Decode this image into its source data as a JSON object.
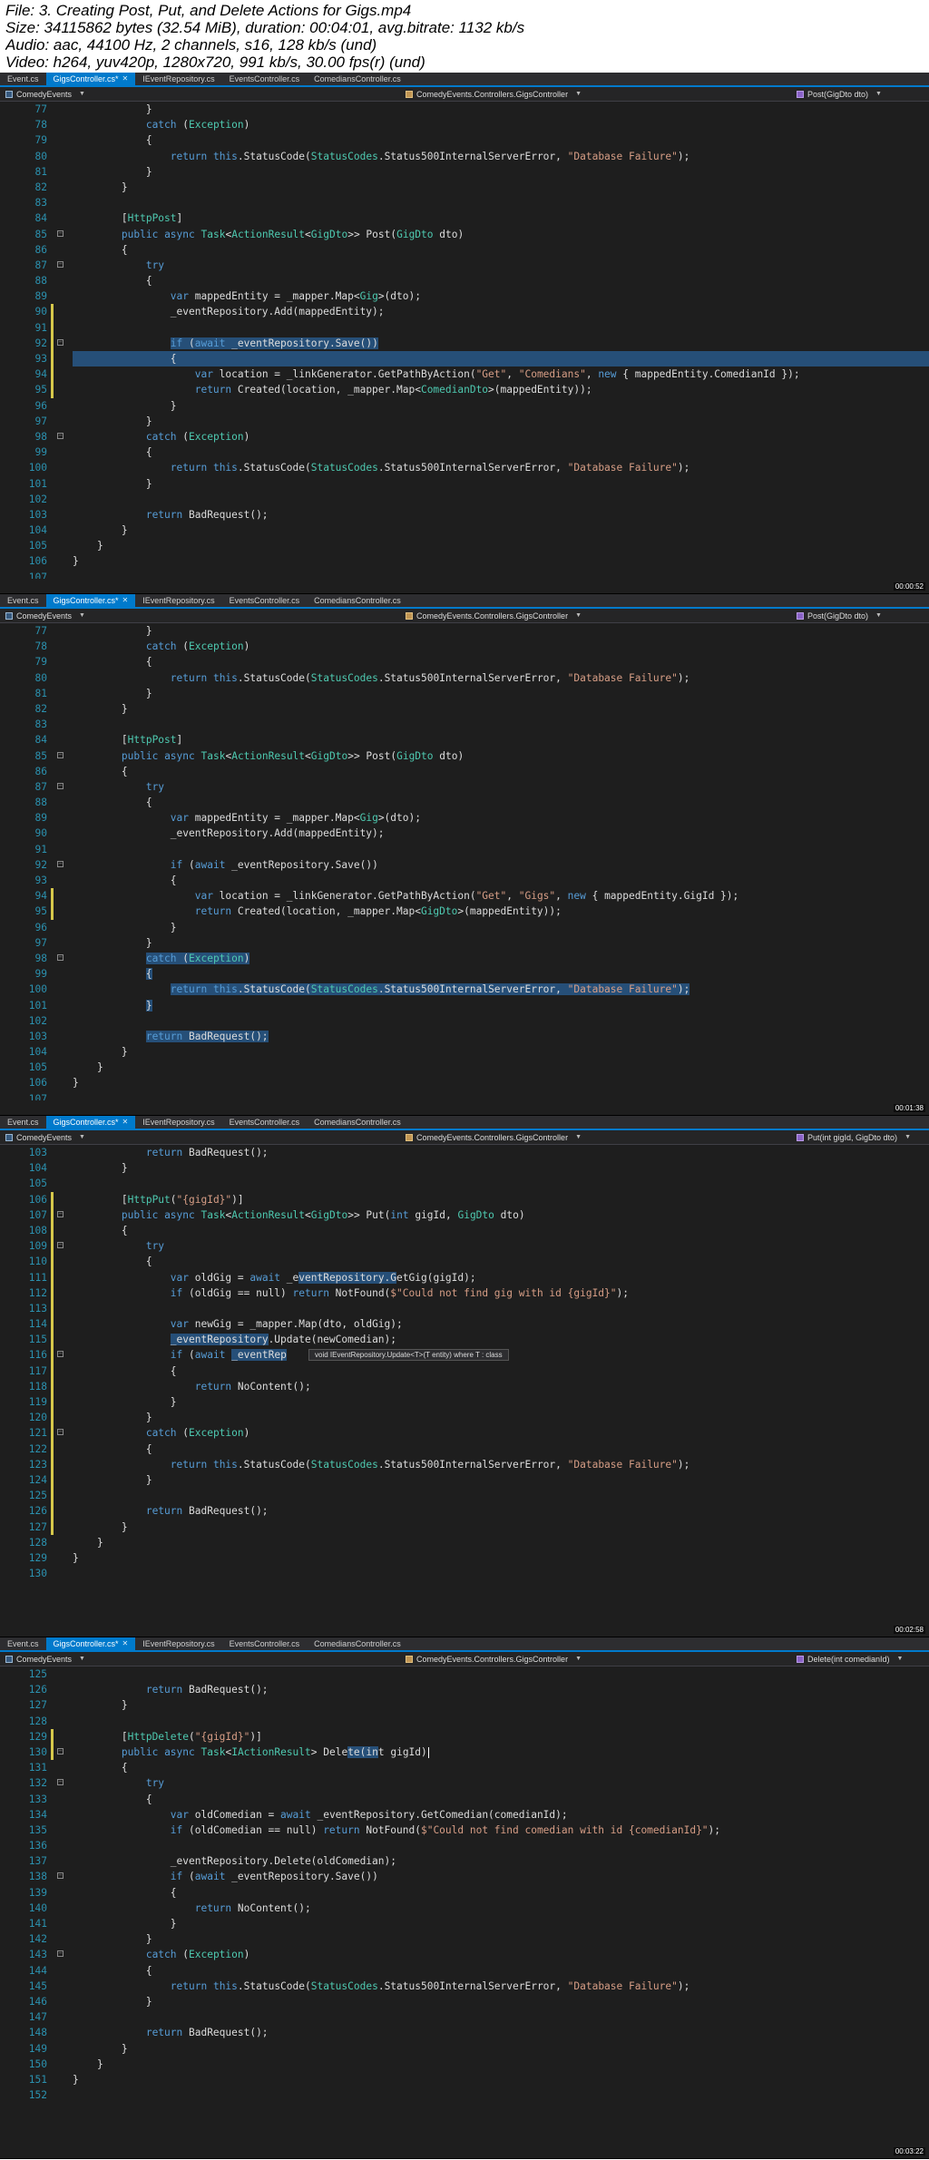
{
  "header": {
    "file": "File: 3. Creating Post, Put, and Delete Actions for Gigs.mp4",
    "size": "Size: 34115862 bytes (32.54 MiB), duration: 00:04:01, avg.bitrate: 1132 kb/s",
    "audio": "Audio: aac, 44100 Hz, 2 channels, s16, 128 kb/s (und)",
    "video": "Video: h264, yuv420p, 1280x720, 991 kb/s, 30.00 fps(r) (und)"
  },
  "colors": {
    "editor_bg": "#1e1e1e",
    "tab_active": "#007acc",
    "keyword": "#569cd6",
    "type": "#4ec9b0",
    "string": "#d69d85",
    "line_number": "#2b91af",
    "selection": "#264f78"
  },
  "panels": [
    {
      "tabs": [
        {
          "label": "Event.cs",
          "active": false,
          "close": ""
        },
        {
          "label": "GigsController.cs*",
          "active": true,
          "close": "✕"
        },
        {
          "label": "IEventRepository.cs",
          "active": false,
          "close": ""
        },
        {
          "label": "EventsController.cs",
          "active": false,
          "close": ""
        },
        {
          "label": "ComediansController.cs",
          "active": false,
          "close": ""
        }
      ],
      "nav": {
        "project": "ComedyEvents",
        "controller": "ComedyEvents.Controllers.GigsController",
        "member": "Post(GigDto dto)"
      },
      "timestamp": "00:00:52",
      "tooltip": null,
      "lines": [
        {
          "n": "77",
          "t": "            }"
        },
        {
          "n": "78",
          "t": "            catch (Exception)"
        },
        {
          "n": "79",
          "t": "            {"
        },
        {
          "n": "80",
          "t": "                return this.StatusCode(StatusCodes.Status500InternalServerError, \"Database Failure\");"
        },
        {
          "n": "81",
          "t": "            }"
        },
        {
          "n": "82",
          "t": "        }"
        },
        {
          "n": "83",
          "t": ""
        },
        {
          "n": "84",
          "t": "        [HttpPost]"
        },
        {
          "n": "85",
          "t": "        public async Task<ActionResult<GigDto>> Post(GigDto dto)"
        },
        {
          "n": "86",
          "t": "        {"
        },
        {
          "n": "87",
          "t": "            try"
        },
        {
          "n": "88",
          "t": "            {"
        },
        {
          "n": "89",
          "t": "                var mappedEntity = _mapper.Map<Gig>(dto);"
        },
        {
          "n": "90",
          "t": "                _eventRepository.Add(mappedEntity);"
        },
        {
          "n": "91",
          "t": ""
        },
        {
          "n": "92",
          "t": "                if (await _eventRepository.Save())"
        },
        {
          "n": "93",
          "t": "                {"
        },
        {
          "n": "94",
          "t": "                    var location = _linkGenerator.GetPathByAction(\"Get\", \"Comedians\", new { mappedEntity.ComedianId });"
        },
        {
          "n": "95",
          "t": "                    return Created(location, _mapper.Map<ComedianDto>(mappedEntity));"
        },
        {
          "n": "96",
          "t": "                }"
        },
        {
          "n": "97",
          "t": "            }"
        },
        {
          "n": "98",
          "t": "            catch (Exception)"
        },
        {
          "n": "99",
          "t": "            {"
        },
        {
          "n": "100",
          "t": "                return this.StatusCode(StatusCodes.Status500InternalServerError, \"Database Failure\");"
        },
        {
          "n": "101",
          "t": "            }"
        },
        {
          "n": "102",
          "t": ""
        },
        {
          "n": "103",
          "t": "            return BadRequest();"
        },
        {
          "n": "104",
          "t": "        }"
        },
        {
          "n": "105",
          "t": "    }"
        },
        {
          "n": "106",
          "t": "}"
        },
        {
          "n": "107",
          "t": ""
        }
      ]
    },
    {
      "tabs": [
        {
          "label": "Event.cs",
          "active": false,
          "close": ""
        },
        {
          "label": "GigsController.cs*",
          "active": true,
          "close": "✕"
        },
        {
          "label": "IEventRepository.cs",
          "active": false,
          "close": ""
        },
        {
          "label": "EventsController.cs",
          "active": false,
          "close": ""
        },
        {
          "label": "ComediansController.cs",
          "active": false,
          "close": ""
        }
      ],
      "nav": {
        "project": "ComedyEvents",
        "controller": "ComedyEvents.Controllers.GigsController",
        "member": "Post(GigDto dto)"
      },
      "timestamp": "00:01:38",
      "tooltip": null,
      "lines": [
        {
          "n": "77",
          "t": "            }"
        },
        {
          "n": "78",
          "t": "            catch (Exception)"
        },
        {
          "n": "79",
          "t": "            {"
        },
        {
          "n": "80",
          "t": "                return this.StatusCode(StatusCodes.Status500InternalServerError, \"Database Failure\");"
        },
        {
          "n": "81",
          "t": "            }"
        },
        {
          "n": "82",
          "t": "        }"
        },
        {
          "n": "83",
          "t": ""
        },
        {
          "n": "84",
          "t": "        [HttpPost]"
        },
        {
          "n": "85",
          "t": "        public async Task<ActionResult<GigDto>> Post(GigDto dto)"
        },
        {
          "n": "86",
          "t": "        {"
        },
        {
          "n": "87",
          "t": "            try"
        },
        {
          "n": "88",
          "t": "            {"
        },
        {
          "n": "89",
          "t": "                var mappedEntity = _mapper.Map<Gig>(dto);"
        },
        {
          "n": "90",
          "t": "                _eventRepository.Add(mappedEntity);"
        },
        {
          "n": "91",
          "t": ""
        },
        {
          "n": "92",
          "t": "                if (await _eventRepository.Save())"
        },
        {
          "n": "93",
          "t": "                {"
        },
        {
          "n": "94",
          "t": "                    var location = _linkGenerator.GetPathByAction(\"Get\", \"Gigs\", new { mappedEntity.GigId });"
        },
        {
          "n": "95",
          "t": "                    return Created(location, _mapper.Map<GigDto>(mappedEntity));"
        },
        {
          "n": "96",
          "t": "                }"
        },
        {
          "n": "97",
          "t": "            }"
        },
        {
          "n": "98",
          "t": "            catch (Exception)"
        },
        {
          "n": "99",
          "t": "            {"
        },
        {
          "n": "100",
          "t": "                return this.StatusCode(StatusCodes.Status500InternalServerError, \"Database Failure\");"
        },
        {
          "n": "101",
          "t": "            }"
        },
        {
          "n": "102",
          "t": ""
        },
        {
          "n": "103",
          "t": "            return BadRequest();"
        },
        {
          "n": "104",
          "t": "        }"
        },
        {
          "n": "105",
          "t": "    }"
        },
        {
          "n": "106",
          "t": "}"
        },
        {
          "n": "107",
          "t": ""
        }
      ]
    },
    {
      "tabs": [
        {
          "label": "Event.cs",
          "active": false,
          "close": ""
        },
        {
          "label": "GigsController.cs*",
          "active": true,
          "close": "✕"
        },
        {
          "label": "IEventRepository.cs",
          "active": false,
          "close": ""
        },
        {
          "label": "EventsController.cs",
          "active": false,
          "close": ""
        },
        {
          "label": "ComediansController.cs",
          "active": false,
          "close": ""
        }
      ],
      "nav": {
        "project": "ComedyEvents",
        "controller": "ComedyEvents.Controllers.GigsController",
        "member": "Put(int gigId, GigDto dto)"
      },
      "timestamp": "00:02:58",
      "tooltip": {
        "text": "void IEventRepository.Update<T>(T entity) where T : class"
      },
      "lines": [
        {
          "n": "103",
          "t": "            return BadRequest();"
        },
        {
          "n": "104",
          "t": "        }"
        },
        {
          "n": "105",
          "t": ""
        },
        {
          "n": "106",
          "t": "        [HttpPut(\"{gigId}\")]"
        },
        {
          "n": "107",
          "t": "        public async Task<ActionResult<GigDto>> Put(int gigId, GigDto dto)"
        },
        {
          "n": "108",
          "t": "        {"
        },
        {
          "n": "109",
          "t": "            try"
        },
        {
          "n": "110",
          "t": "            {"
        },
        {
          "n": "111",
          "t": "                var oldGig = await _eventRepository.GetGig(gigId);"
        },
        {
          "n": "112",
          "t": "                if (oldGig == null) return NotFound($\"Could not find gig with id {gigId}\");"
        },
        {
          "n": "113",
          "t": ""
        },
        {
          "n": "114",
          "t": "                var newGig = _mapper.Map(dto, oldGig);"
        },
        {
          "n": "115",
          "t": "                _eventRepository.Update(newComedian);"
        },
        {
          "n": "116",
          "t": "                if (await _eventRep"
        },
        {
          "n": "117",
          "t": "                {"
        },
        {
          "n": "118",
          "t": "                    return NoContent();"
        },
        {
          "n": "119",
          "t": "                }"
        },
        {
          "n": "120",
          "t": "            }"
        },
        {
          "n": "121",
          "t": "            catch (Exception)"
        },
        {
          "n": "122",
          "t": "            {"
        },
        {
          "n": "123",
          "t": "                return this.StatusCode(StatusCodes.Status500InternalServerError, \"Database Failure\");"
        },
        {
          "n": "124",
          "t": "            }"
        },
        {
          "n": "125",
          "t": ""
        },
        {
          "n": "126",
          "t": "            return BadRequest();"
        },
        {
          "n": "127",
          "t": "        }"
        },
        {
          "n": "128",
          "t": "    }"
        },
        {
          "n": "129",
          "t": "}"
        },
        {
          "n": "130",
          "t": ""
        }
      ]
    },
    {
      "tabs": [
        {
          "label": "Event.cs",
          "active": false,
          "close": ""
        },
        {
          "label": "GigsController.cs*",
          "active": true,
          "close": "✕"
        },
        {
          "label": "IEventRepository.cs",
          "active": false,
          "close": ""
        },
        {
          "label": "EventsController.cs",
          "active": false,
          "close": ""
        },
        {
          "label": "ComediansController.cs",
          "active": false,
          "close": ""
        }
      ],
      "nav": {
        "project": "ComedyEvents",
        "controller": "ComedyEvents.Controllers.GigsController",
        "member": "Delete(int comedianId)"
      },
      "timestamp": "00:03:22",
      "tooltip": null,
      "lines": [
        {
          "n": "125",
          "t": ""
        },
        {
          "n": "126",
          "t": "            return BadRequest();"
        },
        {
          "n": "127",
          "t": "        }"
        },
        {
          "n": "128",
          "t": ""
        },
        {
          "n": "129",
          "t": "        [HttpDelete(\"{gigId}\")]"
        },
        {
          "n": "130",
          "t": "        public async Task<IActionResult> Delete(int gigId)"
        },
        {
          "n": "131",
          "t": "        {"
        },
        {
          "n": "132",
          "t": "            try"
        },
        {
          "n": "133",
          "t": "            {"
        },
        {
          "n": "134",
          "t": "                var oldComedian = await _eventRepository.GetComedian(comedianId);"
        },
        {
          "n": "135",
          "t": "                if (oldComedian == null) return NotFound($\"Could not find comedian with id {comedianId}\");"
        },
        {
          "n": "136",
          "t": ""
        },
        {
          "n": "137",
          "t": "                _eventRepository.Delete(oldComedian);"
        },
        {
          "n": "138",
          "t": "                if (await _eventRepository.Save())"
        },
        {
          "n": "139",
          "t": "                {"
        },
        {
          "n": "140",
          "t": "                    return NoContent();"
        },
        {
          "n": "141",
          "t": "                }"
        },
        {
          "n": "142",
          "t": "            }"
        },
        {
          "n": "143",
          "t": "            catch (Exception)"
        },
        {
          "n": "144",
          "t": "            {"
        },
        {
          "n": "145",
          "t": "                return this.StatusCode(StatusCodes.Status500InternalServerError, \"Database Failure\");"
        },
        {
          "n": "146",
          "t": "            }"
        },
        {
          "n": "147",
          "t": ""
        },
        {
          "n": "148",
          "t": "            return BadRequest();"
        },
        {
          "n": "149",
          "t": "        }"
        },
        {
          "n": "150",
          "t": "    }"
        },
        {
          "n": "151",
          "t": "}"
        },
        {
          "n": "152",
          "t": ""
        }
      ]
    }
  ]
}
